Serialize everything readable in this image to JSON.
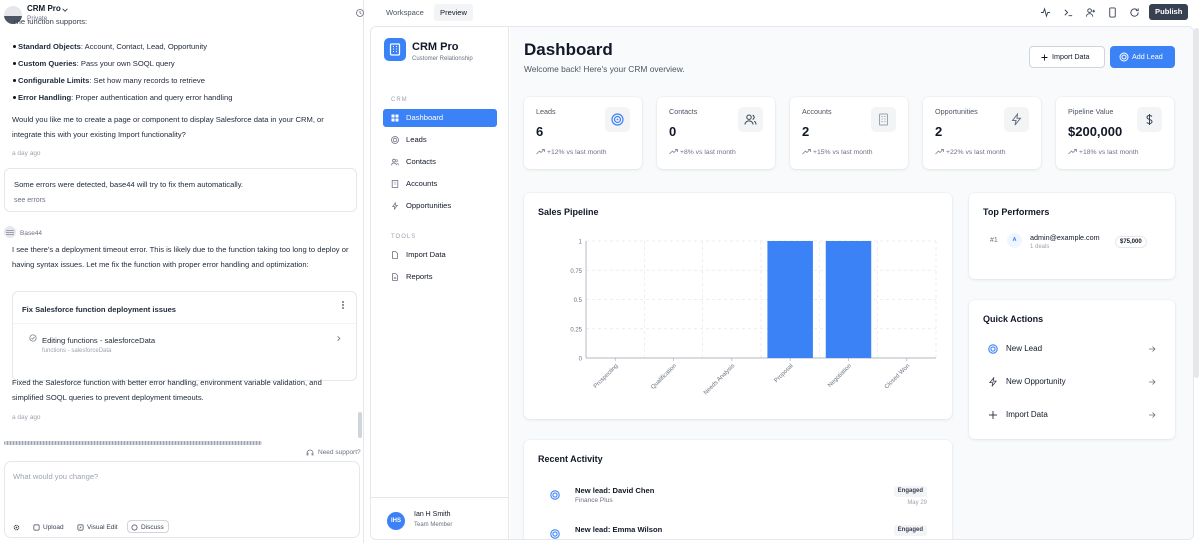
{
  "chat": {
    "app_name": "CRM Pro",
    "visibility": "Private",
    "partial_line": "The function supports:",
    "bullets": [
      {
        "bold": "Standard Objects",
        "rest": ": Account, Contact, Lead, Opportunity"
      },
      {
        "bold": "Custom Queries",
        "rest": ": Pass your own SOQL query"
      },
      {
        "bold": "Configurable Limits",
        "rest": ": Set how many records to retrieve"
      },
      {
        "bold": "Error Handling",
        "rest": ": Proper authentication and query error handling"
      }
    ],
    "question": "Would you like me to create a page or component to display Salesforce data in your CRM, or integrate this with your existing Import functionality?",
    "time1": "a day ago",
    "error_msg": "Some errors were detected, base44 will try to fix them automatically.",
    "see_errors": "see errors",
    "agent_name": "Base44",
    "agent_msg": "I see there's a deployment timeout error. This is likely due to the function taking too long to deploy or having syntax issues. Let me fix the function with proper error handling and optimization:",
    "fix_title": "Fix Salesforce function deployment issues",
    "fix_item": "Editing functions - salesforceData",
    "fix_path": "functions - salesforceData",
    "fixed_msg": "Fixed the Salesforce function with better error handling, environment variable validation, and simplified SOQL queries to prevent deployment timeouts.",
    "time2": "a day ago",
    "need_support": "Need support?",
    "input_placeholder": "What would you change?",
    "upload": "Upload",
    "visual_edit": "Visual Edit",
    "discuss": "Discuss"
  },
  "topbar": {
    "tabs": [
      "Workspace",
      "Preview"
    ],
    "active_tab": "Preview",
    "publish": "Publish"
  },
  "sidebar": {
    "app_name": "CRM Pro",
    "app_sub": "Customer Relationship",
    "section_crm": "CRM",
    "crm_items": [
      {
        "label": "Dashboard",
        "icon": "dashboard-icon",
        "active": true
      },
      {
        "label": "Leads",
        "icon": "target-icon"
      },
      {
        "label": "Contacts",
        "icon": "users-icon"
      },
      {
        "label": "Accounts",
        "icon": "building-icon"
      },
      {
        "label": "Opportunities",
        "icon": "bolt-icon"
      }
    ],
    "section_tools": "TOOLS",
    "tool_items": [
      {
        "label": "Import Data",
        "icon": "import-icon"
      },
      {
        "label": "Reports",
        "icon": "reports-icon"
      }
    ],
    "user_initials": "IHS",
    "user_name": "Ian H Smith",
    "user_role": "Team Member"
  },
  "dashboard": {
    "title": "Dashboard",
    "subtitle": "Welcome back! Here's your CRM overview.",
    "import_button": "Import Data",
    "add_button": "Add Lead",
    "accent_color": "#3b82f6",
    "stats": [
      {
        "label": "Leads",
        "value": "6",
        "change": "+12% vs last month",
        "icon": "target-icon"
      },
      {
        "label": "Contacts",
        "value": "0",
        "change": "+8% vs last month",
        "icon": "users-icon"
      },
      {
        "label": "Accounts",
        "value": "2",
        "change": "+15% vs last month",
        "icon": "building-icon"
      },
      {
        "label": "Opportunities",
        "value": "2",
        "change": "+22% vs last month",
        "icon": "bolt-icon"
      },
      {
        "label": "Pipeline Value",
        "value": "$200,000",
        "change": "+18% vs last month",
        "icon": "dollar-icon"
      }
    ],
    "top_performers_title": "Top Performers",
    "performers": [
      {
        "rank": "#1",
        "initial": "A",
        "email": "admin@example.com",
        "deals": "1 deals",
        "amount": "$75,000"
      }
    ],
    "quick_actions_title": "Quick Actions",
    "quick_actions": [
      {
        "label": "New Lead",
        "icon": "target-icon"
      },
      {
        "label": "New Opportunity",
        "icon": "bolt-icon"
      },
      {
        "label": "Import Data",
        "icon": "plus-icon"
      }
    ],
    "recent_activity_title": "Recent Activity",
    "activities": [
      {
        "title": "New lead: David Chen",
        "company": "Finance Plus",
        "badge": "Engaged",
        "date": "May 29"
      },
      {
        "title": "New lead: Emma Wilson",
        "company": "",
        "badge": "Engaged",
        "date": ""
      }
    ]
  },
  "chart_data": {
    "type": "bar",
    "title": "Sales Pipeline",
    "categories": [
      "Prospecting",
      "Qualification",
      "Needs Analysis",
      "Proposal",
      "Negotiation",
      "Closed Won"
    ],
    "values": [
      0,
      0,
      0,
      1,
      1,
      0
    ],
    "ylim": [
      0,
      1
    ],
    "yticks": [
      "0",
      "0.25",
      "0.5",
      "0.75",
      "1"
    ],
    "bar_color": "#3b82f6",
    "grid": true
  }
}
